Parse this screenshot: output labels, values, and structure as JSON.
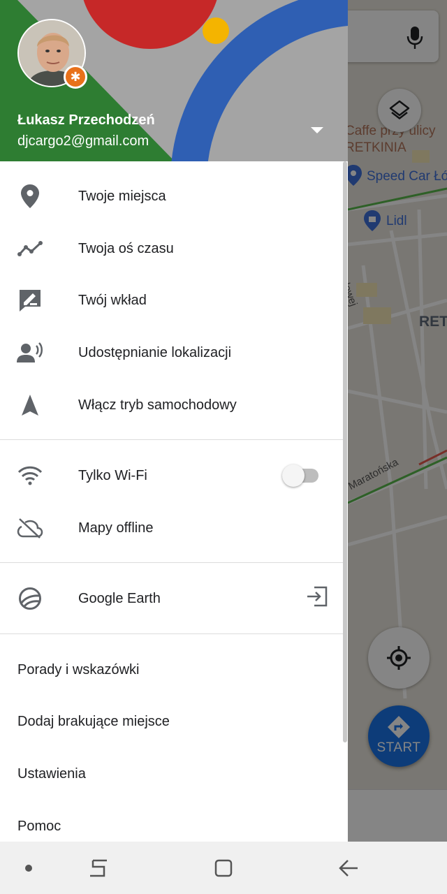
{
  "map": {
    "labels": {
      "cafe": "Caffe przy ulicy",
      "district": "RETKINIA",
      "speed_car": "Speed Car Łó",
      "lidl": "Lidl",
      "district_short": "RET",
      "street_maratonska": "Maratońska",
      "street_side": "alowej"
    },
    "start_label": "START",
    "colors": {
      "accent": "#1a73e8",
      "scrim": "rgba(0,0,0,0.48)"
    }
  },
  "account": {
    "name": "Łukasz Przechodzeń",
    "email": "djcargo2@gmail.com",
    "badge_icon": "local-guide-star-icon"
  },
  "menu": {
    "section1": [
      {
        "label": "Twoje miejsca",
        "icon": "place-pin-icon"
      },
      {
        "label": "Twoja oś czasu",
        "icon": "timeline-icon"
      },
      {
        "label": "Twój wkład",
        "icon": "contribute-icon"
      },
      {
        "label": "Udostępnianie lokalizacji",
        "icon": "location-sharing-icon"
      },
      {
        "label": "Włącz tryb samochodowy",
        "icon": "navigation-arrow-icon"
      }
    ],
    "section2": [
      {
        "label": "Tylko Wi-Fi",
        "icon": "wifi-icon",
        "toggle_on": false
      },
      {
        "label": "Mapy offline",
        "icon": "cloud-off-icon"
      }
    ],
    "section3": [
      {
        "label": "Google Earth",
        "icon": "google-earth-icon"
      }
    ],
    "section4": [
      {
        "label": "Porady i wskazówki"
      },
      {
        "label": "Dodaj brakujące miejsce"
      },
      {
        "label": "Ustawienia"
      },
      {
        "label": "Pomoc"
      }
    ]
  }
}
